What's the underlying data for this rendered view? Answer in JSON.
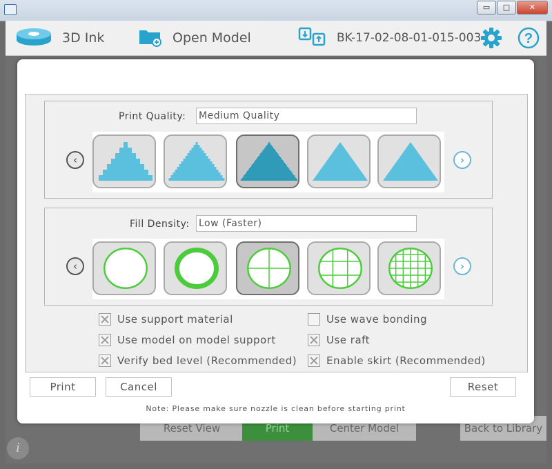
{
  "window": {
    "minimize": "▭",
    "maximize": "□",
    "close": "✕"
  },
  "toolbar": {
    "ink_label": "3D Ink",
    "open_label": "Open Model",
    "model_id": "BK-17-02-08-01-015-003"
  },
  "background_buttons": {
    "reset_view": "Reset View",
    "print": "Print",
    "center_model": "Center Model",
    "back_to_library": "Back to Library",
    "info": "i"
  },
  "print_quality": {
    "label": "Print Quality:",
    "value": "Medium Quality",
    "selected_index": 2,
    "tiles": [
      "draft-quality",
      "low-quality",
      "medium-quality",
      "high-quality",
      "highest-quality"
    ]
  },
  "fill_density": {
    "label": "Fill Density:",
    "value": "Low (Faster)",
    "selected_index": 2,
    "tiles": [
      "hollow",
      "shell",
      "low",
      "medium",
      "high"
    ]
  },
  "options": [
    {
      "label": "Use support material",
      "checked": true
    },
    {
      "label": "Use wave bonding",
      "checked": false
    },
    {
      "label": "Use model on model support",
      "checked": true
    },
    {
      "label": "Use raft",
      "checked": true
    },
    {
      "label": "Verify bed level (Recommended)",
      "checked": true
    },
    {
      "label": "Enable skirt (Recommended)",
      "checked": true
    }
  ],
  "buttons": {
    "print": "Print",
    "cancel": "Cancel",
    "reset": "Reset"
  },
  "note": "Note: Please make sure nozzle is clean before starting print",
  "colors": {
    "triangle": "#5bc0de",
    "triangle_selected": "#2f9bb8",
    "circle": "#4ccc3c",
    "accent": "#2e9acb"
  }
}
